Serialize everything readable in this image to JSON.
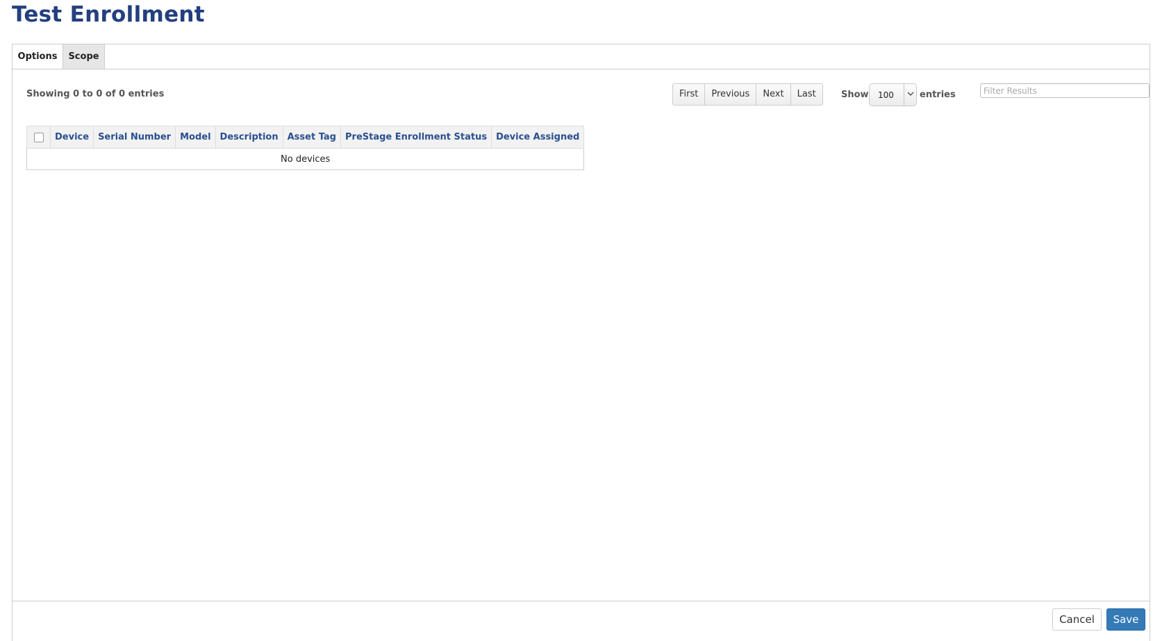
{
  "page": {
    "title": "Test Enrollment"
  },
  "tabs": [
    {
      "label": "Options",
      "active": false
    },
    {
      "label": "Scope",
      "active": true
    }
  ],
  "list": {
    "info": "Showing 0 to 0 of 0 entries",
    "pagination": {
      "first": "First",
      "previous": "Previous",
      "next": "Next",
      "last": "Last"
    },
    "length": {
      "show_label": "Show",
      "value": "100",
      "entries_label": "entries"
    },
    "filter": {
      "placeholder": "Filter Results",
      "value": ""
    },
    "columns": [
      "Device",
      "Serial Number",
      "Model",
      "Description",
      "Asset Tag",
      "PreStage Enrollment Status",
      "Device Assigned"
    ],
    "empty_message": "No devices"
  },
  "footer": {
    "cancel": "Cancel",
    "save": "Save"
  },
  "colors": {
    "title": "#233f7f",
    "header_text": "#2a4f8f",
    "save_button": "#337ab7"
  }
}
